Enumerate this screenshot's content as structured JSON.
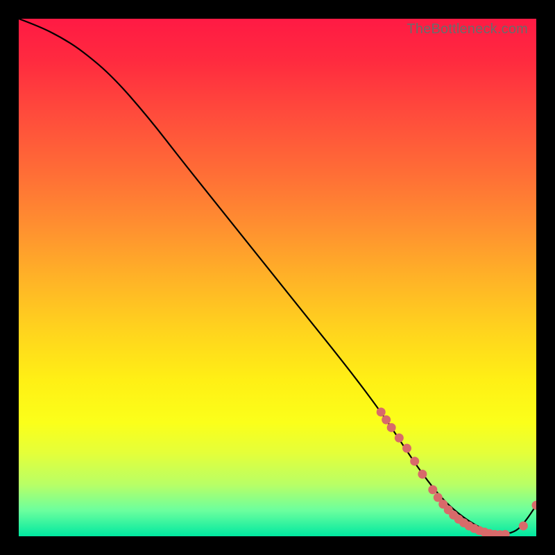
{
  "watermark": "TheBottleneck.com",
  "chart_data": {
    "type": "line",
    "title": "",
    "xlabel": "",
    "ylabel": "",
    "xlim": [
      0,
      100
    ],
    "ylim": [
      0,
      100
    ],
    "series": [
      {
        "name": "bottleneck-curve",
        "x": [
          0,
          4,
          8,
          12,
          18,
          25,
          32,
          40,
          48,
          56,
          64,
          70,
          74,
          78,
          82,
          86,
          90,
          93,
          96,
          98,
          100
        ],
        "y": [
          100,
          98.5,
          96.5,
          94,
          89,
          81,
          72,
          62,
          52,
          42,
          32,
          24,
          18,
          12,
          7,
          3.5,
          1.2,
          0.3,
          0.8,
          3,
          6
        ]
      }
    ],
    "highlight_points": {
      "name": "highlighted-range",
      "x": [
        70,
        71,
        72,
        73.5,
        75,
        76.5,
        78,
        80,
        81,
        82,
        83,
        84,
        85,
        86,
        87,
        88,
        89,
        90,
        91,
        92,
        93,
        94,
        97.5,
        100
      ],
      "y": [
        24,
        22.5,
        21,
        19,
        17,
        14.5,
        12,
        9,
        7.5,
        6.2,
        5.1,
        4.1,
        3.3,
        2.6,
        2.0,
        1.5,
        1.1,
        0.8,
        0.5,
        0.35,
        0.3,
        0.35,
        2.0,
        6.0
      ]
    }
  }
}
